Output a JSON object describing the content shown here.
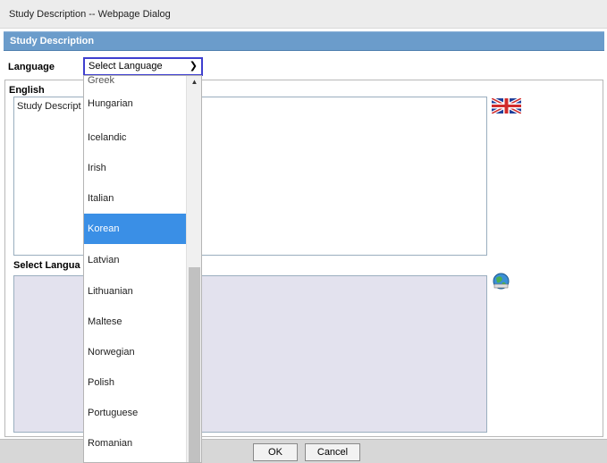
{
  "window": {
    "title": "Study Description -- Webpage Dialog"
  },
  "header": {
    "title": "Study Description"
  },
  "language": {
    "label": "Language",
    "selected": "Select Language"
  },
  "english": {
    "label": "English",
    "text": "Study Descript"
  },
  "translation": {
    "label": "Select Langua"
  },
  "dropdown": {
    "partial_top": "Greek",
    "items": [
      "Hungarian",
      "Icelandic",
      "Irish",
      "Italian",
      "Korean",
      "Latvian",
      "Lithuanian",
      "Maltese",
      "Norwegian",
      "Polish",
      "Portuguese",
      "Romanian"
    ],
    "selected_item": "Korean"
  },
  "buttons": {
    "ok": "OK",
    "cancel": "Cancel"
  },
  "icons": {
    "flag": "uk-flag-icon",
    "globe": "globe-icon",
    "chevron": "chevron-down-icon"
  },
  "colors": {
    "header": "#6b9ccb",
    "selected": "#3a8fe6",
    "select_border": "#3f3fcf"
  }
}
